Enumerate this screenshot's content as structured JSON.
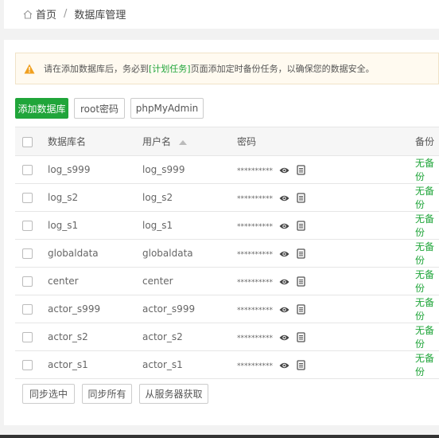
{
  "breadcrumb": {
    "home": "首页",
    "separator": "/",
    "current": "数据库管理"
  },
  "alert": {
    "before": "请在添加数据库后，务必到",
    "link": "[计划任务]",
    "after": "页面添加定时备份任务，以确保您的数据安全。"
  },
  "toolbar": {
    "add_db": "添加数据库",
    "root_pwd": "root密码",
    "phpmyadmin": "phpMyAdmin"
  },
  "table": {
    "headers": {
      "name": "数据库名",
      "user": "用户名",
      "password": "密码",
      "backup": "备份"
    },
    "rows": [
      {
        "name": "log_s999",
        "user": "log_s999",
        "password": "**********",
        "backup": "无备份"
      },
      {
        "name": "log_s2",
        "user": "log_s2",
        "password": "**********",
        "backup": "无备份"
      },
      {
        "name": "log_s1",
        "user": "log_s1",
        "password": "**********",
        "backup": "无备份"
      },
      {
        "name": "globaldata",
        "user": "globaldata",
        "password": "**********",
        "backup": "无备份"
      },
      {
        "name": "center",
        "user": "center",
        "password": "**********",
        "backup": "无备份"
      },
      {
        "name": "actor_s999",
        "user": "actor_s999",
        "password": "**********",
        "backup": "无备份"
      },
      {
        "name": "actor_s2",
        "user": "actor_s2",
        "password": "**********",
        "backup": "无备份"
      },
      {
        "name": "actor_s1",
        "user": "actor_s1",
        "password": "**********",
        "backup": "无备份"
      }
    ]
  },
  "bottom": {
    "sync_selected": "同步选中",
    "sync_all": "同步所有",
    "fetch_server": "从服务器获取"
  },
  "colors": {
    "accent": "#20a53a",
    "warning": "#f0a020"
  }
}
